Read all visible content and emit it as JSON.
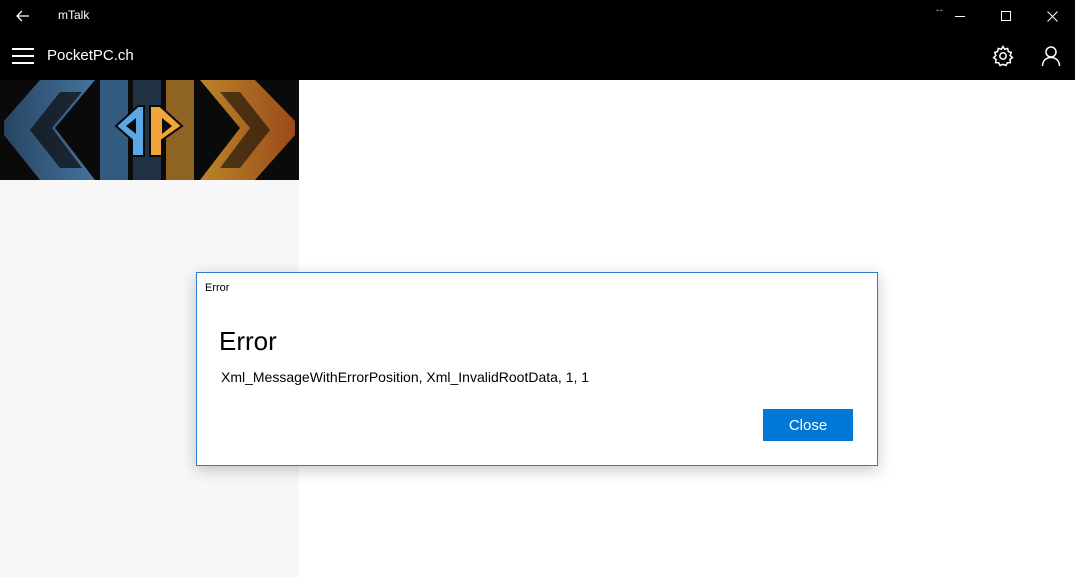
{
  "window": {
    "app_title": "mTalk",
    "resize_hint": "↔",
    "icons": [
      "back-arrow-icon",
      "minimize-icon",
      "maximize-icon",
      "close-icon"
    ]
  },
  "header": {
    "site_title": "PocketPC.ch",
    "icons": [
      "hamburger-menu-icon",
      "gear-icon",
      "user-icon"
    ]
  },
  "banner": {
    "logo": "pocketpc-logo",
    "colors": [
      "#3b6c99",
      "#d6902a",
      "#f2a63a",
      "#5aa8e6"
    ]
  },
  "dialog": {
    "caption": "Error",
    "heading": "Error",
    "message": "Xml_MessageWithErrorPosition, Xml_InvalidRootData, 1, 1",
    "close_label": "Close",
    "accent": "#0078d7"
  }
}
